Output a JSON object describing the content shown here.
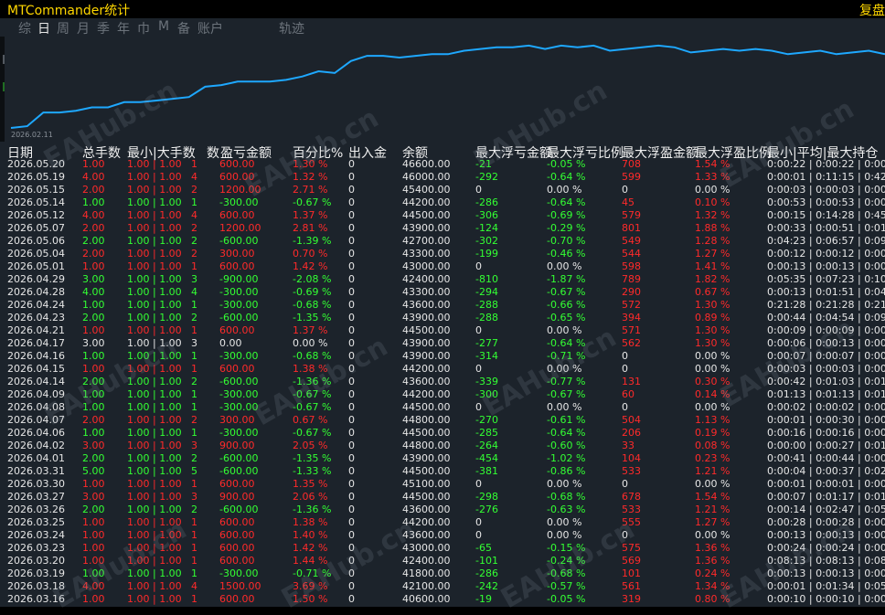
{
  "window": {
    "title": "MTCommander统计",
    "replay_label": "复盘"
  },
  "tabs": [
    "综",
    "日",
    "周",
    "月",
    "季",
    "年",
    "巾",
    "M",
    "备",
    "账户",
    "轨迹"
  ],
  "chart": {
    "start_date_label": "2026.02.11",
    "line_color": "#1ea8ff",
    "balance_points": [
      40600,
      40700,
      41500,
      41500,
      41600,
      41800,
      41800,
      42100,
      42100,
      42200,
      42300,
      42400,
      43000,
      43100,
      43300,
      43300,
      43300,
      43400,
      43600,
      43900,
      43800,
      44500,
      44800,
      44800,
      44700,
      44800,
      44900,
      44900,
      45100,
      45200,
      45300,
      45300,
      45400,
      45200,
      45400,
      45300,
      45400,
      45100,
      45200,
      45300,
      45400,
      45300,
      45000,
      45100,
      45200,
      45100,
      45200,
      45100,
      44900,
      45000,
      45100,
      44900,
      45000,
      45100,
      44900
    ]
  },
  "table": {
    "headers": [
      "日期",
      "总手数",
      "最小|大手数",
      "数",
      "盈亏金额",
      "百分比%",
      "出入金",
      "余额",
      "最大浮亏金额",
      "最大浮亏比例",
      "最大浮盈金额",
      "最大浮盈比例",
      "最小|平均|最大持仓"
    ],
    "rows": [
      [
        "2026.05.20",
        "1.00",
        "1.00 | 1.00",
        "1",
        "600.00",
        "1.30 %",
        "0",
        "46600.00",
        "-21",
        "-0.05 %",
        "708",
        "1.54 %",
        "0:00:22 | 0:00:22 | 0:00"
      ],
      [
        "2026.05.19",
        "4.00",
        "1.00 | 1.00",
        "4",
        "600.00",
        "1.32 %",
        "0",
        "46000.00",
        "-292",
        "-0.64 %",
        "599",
        "1.33 %",
        "0:00:01 | 0:11:15 | 0:42"
      ],
      [
        "2026.05.15",
        "2.00",
        "1.00 | 1.00",
        "2",
        "1200.00",
        "2.71 %",
        "0",
        "45400.00",
        "0",
        "0.00 %",
        "0",
        "0.00 %",
        "0:00:03 | 0:00:03 | 0:00"
      ],
      [
        "2026.05.14",
        "1.00",
        "1.00 | 1.00",
        "1",
        "-300.00",
        "-0.67 %",
        "0",
        "44200.00",
        "-286",
        "-0.64 %",
        "45",
        "0.10 %",
        "0:00:53 | 0:00:53 | 0:00"
      ],
      [
        "2026.05.12",
        "4.00",
        "1.00 | 1.00",
        "4",
        "600.00",
        "1.37 %",
        "0",
        "44500.00",
        "-306",
        "-0.69 %",
        "579",
        "1.32 %",
        "0:00:15 | 0:14:28 | 0:45"
      ],
      [
        "2026.05.07",
        "2.00",
        "1.00 | 1.00",
        "2",
        "1200.00",
        "2.81 %",
        "0",
        "43900.00",
        "-124",
        "-0.29 %",
        "801",
        "1.88 %",
        "0:00:33 | 0:00:51 | 0:01"
      ],
      [
        "2026.05.06",
        "2.00",
        "1.00 | 1.00",
        "2",
        "-600.00",
        "-1.39 %",
        "0",
        "42700.00",
        "-302",
        "-0.70 %",
        "549",
        "1.28 %",
        "0:04:23 | 0:06:57 | 0:09"
      ],
      [
        "2026.05.04",
        "2.00",
        "1.00 | 1.00",
        "2",
        "300.00",
        "0.70 %",
        "0",
        "43300.00",
        "-199",
        "-0.46 %",
        "544",
        "1.27 %",
        "0:00:12 | 0:00:12 | 0:00"
      ],
      [
        "2026.05.01",
        "1.00",
        "1.00 | 1.00",
        "1",
        "600.00",
        "1.42 %",
        "0",
        "43000.00",
        "0",
        "0.00 %",
        "598",
        "1.41 %",
        "0:00:13 | 0:00:13 | 0:00"
      ],
      [
        "2026.04.29",
        "3.00",
        "1.00 | 1.00",
        "3",
        "-900.00",
        "-2.08 %",
        "0",
        "42400.00",
        "-810",
        "-1.87 %",
        "789",
        "1.82 %",
        "0:05:35 | 0:07:23 | 0:10"
      ],
      [
        "2026.04.28",
        "4.00",
        "1.00 | 1.00",
        "4",
        "-300.00",
        "-0.69 %",
        "0",
        "43300.00",
        "-294",
        "-0.67 %",
        "290",
        "0.67 %",
        "0:00:13 | 0:01:51 | 0:04"
      ],
      [
        "2026.04.24",
        "1.00",
        "1.00 | 1.00",
        "1",
        "-300.00",
        "-0.68 %",
        "0",
        "43600.00",
        "-288",
        "-0.66 %",
        "572",
        "1.30 %",
        "0:21:28 | 0:21:28 | 0:21"
      ],
      [
        "2026.04.23",
        "2.00",
        "1.00 | 1.00",
        "2",
        "-600.00",
        "-1.35 %",
        "0",
        "43900.00",
        "-288",
        "-0.65 %",
        "394",
        "0.89 %",
        "0:00:44 | 0:04:54 | 0:09"
      ],
      [
        "2026.04.21",
        "1.00",
        "1.00 | 1.00",
        "1",
        "600.00",
        "1.37 %",
        "0",
        "44500.00",
        "0",
        "0.00 %",
        "571",
        "1.30 %",
        "0:00:09 | 0:00:09 | 0:00"
      ],
      [
        "2026.04.17",
        "3.00",
        "1.00 | 1.00",
        "3",
        "0.00",
        "0.00 %",
        "0",
        "43900.00",
        "-277",
        "-0.64 %",
        "562",
        "1.30 %",
        "0:00:06 | 0:00:13 | 0:00"
      ],
      [
        "2026.04.16",
        "1.00",
        "1.00 | 1.00",
        "1",
        "-300.00",
        "-0.68 %",
        "0",
        "43900.00",
        "-314",
        "-0.71 %",
        "0",
        "0.00 %",
        "0:00:07 | 0:00:07 | 0:00"
      ],
      [
        "2026.04.15",
        "1.00",
        "1.00 | 1.00",
        "1",
        "600.00",
        "1.38 %",
        "0",
        "44200.00",
        "0",
        "0.00 %",
        "0",
        "0.00 %",
        "0:00:03 | 0:00:03 | 0:00"
      ],
      [
        "2026.04.14",
        "2.00",
        "1.00 | 1.00",
        "2",
        "-600.00",
        "-1.36 %",
        "0",
        "43600.00",
        "-339",
        "-0.77 %",
        "131",
        "0.30 %",
        "0:00:42 | 0:01:03 | 0:01"
      ],
      [
        "2026.04.09",
        "1.00",
        "1.00 | 1.00",
        "1",
        "-300.00",
        "-0.67 %",
        "0",
        "44200.00",
        "-300",
        "-0.67 %",
        "60",
        "0.14 %",
        "0:01:13 | 0:01:13 | 0:01"
      ],
      [
        "2026.04.08",
        "1.00",
        "1.00 | 1.00",
        "1",
        "-300.00",
        "-0.67 %",
        "0",
        "44500.00",
        "0",
        "0.00 %",
        "0",
        "0.00 %",
        "0:00:02 | 0:00:02 | 0:00"
      ],
      [
        "2026.04.07",
        "2.00",
        "1.00 | 1.00",
        "2",
        "300.00",
        "0.67 %",
        "0",
        "44800.00",
        "-270",
        "-0.61 %",
        "504",
        "1.13 %",
        "0:00:01 | 0:00:30 | 0:00"
      ],
      [
        "2026.04.06",
        "1.00",
        "1.00 | 1.00",
        "1",
        "-300.00",
        "-0.67 %",
        "0",
        "44500.00",
        "-285",
        "-0.64 %",
        "206",
        "0.19 %",
        "0:00:16 | 0:00:16 | 0:00"
      ],
      [
        "2026.04.02",
        "3.00",
        "1.00 | 1.00",
        "3",
        "900.00",
        "2.05 %",
        "0",
        "44800.00",
        "-264",
        "-0.60 %",
        "33",
        "0.08 %",
        "0:00:00 | 0:00:27 | 0:01"
      ],
      [
        "2026.04.01",
        "2.00",
        "1.00 | 1.00",
        "2",
        "-600.00",
        "-1.35 %",
        "0",
        "43900.00",
        "-454",
        "-1.02 %",
        "104",
        "0.23 %",
        "0:00:41 | 0:00:44 | 0:00"
      ],
      [
        "2026.03.31",
        "5.00",
        "1.00 | 1.00",
        "5",
        "-600.00",
        "-1.33 %",
        "0",
        "44500.00",
        "-381",
        "-0.86 %",
        "533",
        "1.21 %",
        "0:00:04 | 0:00:37 | 0:02"
      ],
      [
        "2026.03.30",
        "1.00",
        "1.00 | 1.00",
        "1",
        "600.00",
        "1.35 %",
        "0",
        "45100.00",
        "0",
        "0.00 %",
        "0",
        "0.00 %",
        "0:00:01 | 0:00:01 | 0:00"
      ],
      [
        "2026.03.27",
        "3.00",
        "1.00 | 1.00",
        "3",
        "900.00",
        "2.06 %",
        "0",
        "44500.00",
        "-298",
        "-0.68 %",
        "678",
        "1.54 %",
        "0:00:07 | 0:01:17 | 0:01"
      ],
      [
        "2026.03.26",
        "2.00",
        "1.00 | 1.00",
        "2",
        "-600.00",
        "-1.36 %",
        "0",
        "43600.00",
        "-276",
        "-0.63 %",
        "533",
        "1.21 %",
        "0:00:14 | 0:02:47 | 0:05"
      ],
      [
        "2026.03.25",
        "1.00",
        "1.00 | 1.00",
        "1",
        "600.00",
        "1.38 %",
        "0",
        "44200.00",
        "0",
        "0.00 %",
        "555",
        "1.27 %",
        "0:00:28 | 0:00:28 | 0:00"
      ],
      [
        "2026.03.24",
        "1.00",
        "1.00 | 1.00",
        "1",
        "600.00",
        "1.40 %",
        "0",
        "43600.00",
        "0",
        "0.00 %",
        "0",
        "0.00 %",
        "0:00:13 | 0:00:13 | 0:00"
      ],
      [
        "2026.03.23",
        "1.00",
        "1.00 | 1.00",
        "1",
        "600.00",
        "1.42 %",
        "0",
        "43000.00",
        "-65",
        "-0.15 %",
        "575",
        "1.36 %",
        "0:00:24 | 0:00:24 | 0:00"
      ],
      [
        "2026.03.20",
        "1.00",
        "1.00 | 1.00",
        "1",
        "600.00",
        "1.44 %",
        "0",
        "42400.00",
        "-101",
        "-0.24 %",
        "569",
        "1.36 %",
        "0:08:13 | 0:08:13 | 0:08"
      ],
      [
        "2026.03.19",
        "1.00",
        "1.00 | 1.00",
        "1",
        "-300.00",
        "-0.71 %",
        "0",
        "41800.00",
        "-286",
        "-0.68 %",
        "101",
        "0.24 %",
        "0:00:13 | 0:00:13 | 0:00"
      ],
      [
        "2026.03.18",
        "4.00",
        "1.00 | 1.00",
        "4",
        "1500.00",
        "3.69 %",
        "0",
        "42100.00",
        "-242",
        "-0.57 %",
        "561",
        "1.34 %",
        "0:00:01 | 0:01:34 | 0:05"
      ],
      [
        "2026.03.16",
        "1.00",
        "1.00 | 1.00",
        "1",
        "600.00",
        "1.50 %",
        "0",
        "40600.00",
        "-19",
        "-0.05 %",
        "319",
        "0.80 %",
        "0:00:10 | 0:00:10 | 0:00"
      ]
    ]
  },
  "colors": {
    "profit": "#ff2a2a",
    "loss": "#33ff33",
    "neutral": "#e6e6e6",
    "panel_bg": "#1c232b",
    "title": "#ffd700"
  },
  "watermark": "EAHub.cn"
}
